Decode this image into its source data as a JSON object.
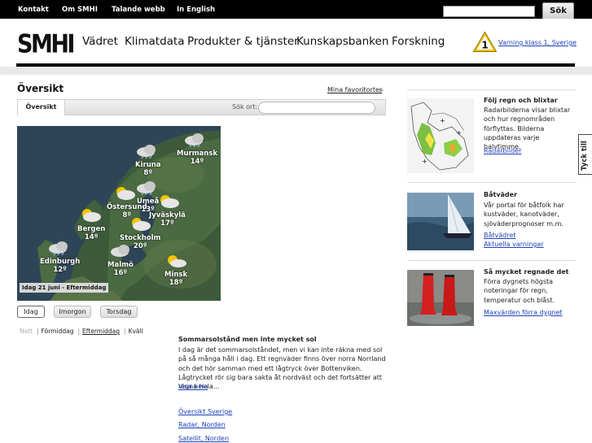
{
  "topbar": {
    "links": [
      "Kontakt",
      "Om SMHI",
      "Talande webb",
      "In English"
    ],
    "search_button": "Sök"
  },
  "header": {
    "logo": "SMHI",
    "nav": [
      "Vädret",
      "Klimatdata",
      "Produkter & tjänster",
      "Kunskapsbanken",
      "Forskning"
    ],
    "warning_level": "1",
    "warning_link": "Varning klass 1, Sverige"
  },
  "overview": {
    "title": "Översikt",
    "favorites_link": "Mina favoritorter",
    "tab_label": "Översikt",
    "search_label": "Sök ort:"
  },
  "map": {
    "cities": [
      {
        "name": "Murmansk",
        "temp": "14º"
      },
      {
        "name": "Kiruna",
        "temp": "8º"
      },
      {
        "name": "Umeå",
        "temp": "13º"
      },
      {
        "name": "Östersund",
        "temp": "8º"
      },
      {
        "name": "Jyväskylä",
        "temp": "17º"
      },
      {
        "name": "Bergen",
        "temp": "14º"
      },
      {
        "name": "Stockholm",
        "temp": "20º"
      },
      {
        "name": "Edinburgh",
        "temp": "12º"
      },
      {
        "name": "Malmö",
        "temp": "16º"
      },
      {
        "name": "Minsk",
        "temp": "18º"
      }
    ],
    "date_label": "Idag 21 juni - Eftermiddag"
  },
  "day_buttons": [
    "Idag",
    "Imorgon",
    "Torsdag"
  ],
  "timeline": {
    "natt": "Natt",
    "formiddag": "Förmiddag",
    "eftermiddag": "Eftermiddag",
    "kvall": "Kväll",
    "sep": "|"
  },
  "news": {
    "title": "Sommarsolstånd men inte mycket sol",
    "body": "I dag är det sommarsolståndet, men vi kan inte räkna med sol på så många håll i dag. Ett regnväder finns över norra Norrland och det hör samman med ett lågtryck över Bottenviken. Lågtrycket rör sig bara sakta åt nordväst och det fortsätter att regna hela...",
    "read_more": "Visa hela",
    "links": [
      "Översikt Sverige",
      "Radar, Norden",
      "Satellit, Norden"
    ]
  },
  "cards": [
    {
      "title": "Följ regn och blixtar",
      "text": "Radarbilderna visar blixtar och hur regnområden förflyttas. Bilderna uppdateras varje halvtimme.",
      "links": [
        "Radarbilder"
      ]
    },
    {
      "title": "Båtväder",
      "text": "Vår portal för båtfolk har kustväder, kanotväder, sjöväderprognoser m.m.",
      "links": [
        "Båtvädret",
        "Aktuella varningar"
      ]
    },
    {
      "title": "Så mycket regnade det",
      "text": "Förra dygnets högsta noteringar för regn, temperatur och blåst.",
      "links": [
        "Maxvärden förra dygnet"
      ]
    }
  ],
  "feedback_tab": "Tyck till",
  "colors": {
    "link": "#1c3fb8",
    "warning_yellow": "#f2c500",
    "topbar": "#000000"
  }
}
